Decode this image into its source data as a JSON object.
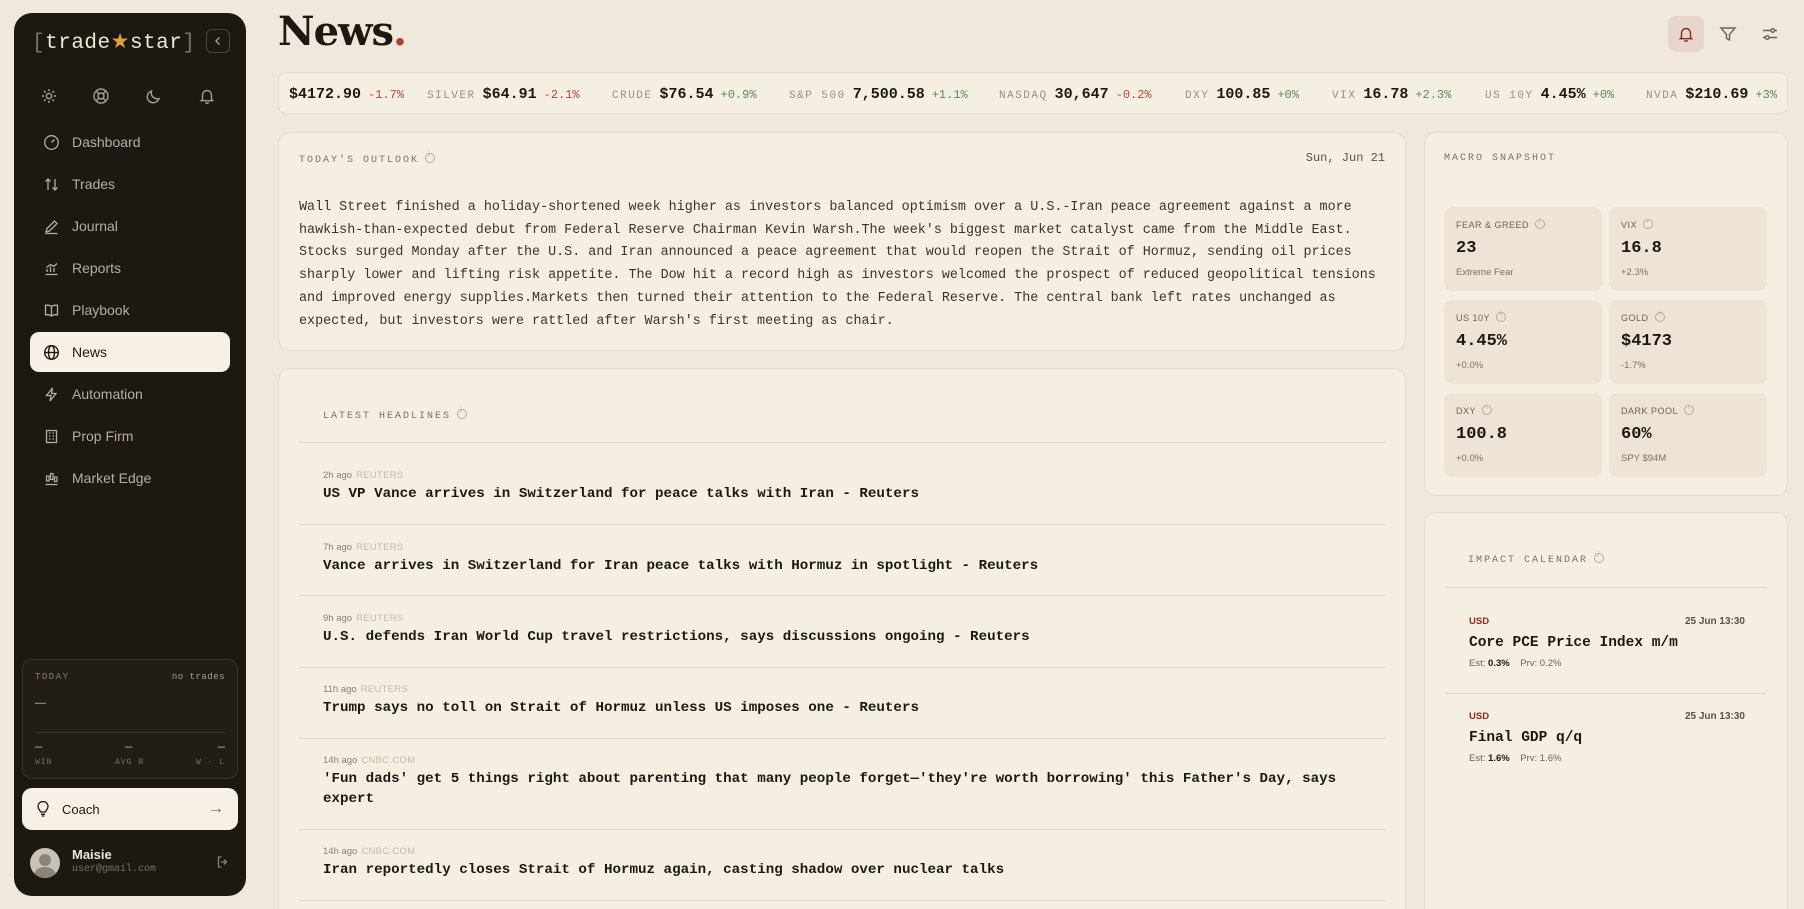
{
  "app": {
    "logo_left": "[",
    "logo_a": "trade",
    "logo_star": "★",
    "logo_b": "star",
    "logo_right": "]"
  },
  "sidebar": {
    "items": [
      {
        "label": "Dashboard",
        "icon": "dashboard-gauge-icon"
      },
      {
        "label": "Trades",
        "icon": "arrows-up-down-icon"
      },
      {
        "label": "Journal",
        "icon": "pen-icon"
      },
      {
        "label": "Reports",
        "icon": "chart-icon"
      },
      {
        "label": "Playbook",
        "icon": "book-icon"
      },
      {
        "label": "News",
        "icon": "globe-icon",
        "active": true
      },
      {
        "label": "Automation",
        "icon": "lightning-icon"
      },
      {
        "label": "Prop Firm",
        "icon": "building-icon"
      },
      {
        "label": "Market Edge",
        "icon": "candles-icon"
      }
    ],
    "today": {
      "label": "TODAY",
      "status": "no trades",
      "value": "—",
      "win_value": "—",
      "win_label": "WIN",
      "avgr_value": "—",
      "avgr_label": "AVG R",
      "wl_value": "—",
      "wl_label": "W · L"
    },
    "coach": {
      "label": "Coach",
      "arrow": "→"
    },
    "user": {
      "name": "Maisie",
      "email": "user@gmail.com"
    }
  },
  "header": {
    "title": "News",
    "title_dot": "."
  },
  "ticker": [
    {
      "symbol": "",
      "value": "$4172.90",
      "change": "-1.7%",
      "dir": "neg"
    },
    {
      "symbol": "SILVER",
      "value": "$64.91",
      "change": "-2.1%",
      "dir": "neg"
    },
    {
      "symbol": "CRUDE",
      "value": "$76.54",
      "change": "+0.9%",
      "dir": "pos"
    },
    {
      "symbol": "S&P 500",
      "value": "7,500.58",
      "change": "+1.1%",
      "dir": "pos"
    },
    {
      "symbol": "NASDAQ",
      "value": "30,647",
      "change": "-0.2%",
      "dir": "neg"
    },
    {
      "symbol": "DXY",
      "value": "100.85",
      "change": "+0%",
      "dir": "pos"
    },
    {
      "symbol": "VIX",
      "value": "16.78",
      "change": "+2.3%",
      "dir": "pos"
    },
    {
      "symbol": "US 10Y",
      "value": "4.45%",
      "change": "+0%",
      "dir": "pos"
    },
    {
      "symbol": "NVDA",
      "value": "$210.69",
      "change": "+3%",
      "dir": "pos"
    }
  ],
  "outlook": {
    "label": "TODAY'S OUTLOOK",
    "date": "Sun, Jun 21",
    "text": "Wall Street finished a holiday-shortened week higher as investors balanced optimism over a U.S.-Iran peace agreement against a more hawkish-than-expected debut from Federal Reserve Chairman Kevin Warsh.The week's biggest market catalyst came from the Middle East. Stocks surged Monday after the U.S. and Iran announced a peace agreement that would reopen the Strait of Hormuz, sending oil prices sharply lower and lifting risk appetite. The Dow hit a record high as investors welcomed the prospect of reduced geopolitical tensions and improved energy supplies.Markets then turned their attention to the Federal Reserve. The central bank left rates unchanged as expected, but investors were rattled after Warsh's first meeting as chair."
  },
  "headlines": {
    "label": "LATEST HEADLINES",
    "items": [
      {
        "time": "2h ago",
        "source": "REUTERS",
        "title": "US VP Vance arrives in Switzerland for peace talks with Iran - Reuters"
      },
      {
        "time": "7h ago",
        "source": "REUTERS",
        "title": "Vance arrives in Switzerland for Iran peace talks with Hormuz in spotlight - Reuters"
      },
      {
        "time": "9h ago",
        "source": "REUTERS",
        "title": "U.S. defends Iran World Cup travel restrictions, says discussions ongoing - Reuters"
      },
      {
        "time": "11h ago",
        "source": "REUTERS",
        "title": "Trump says no toll on Strait of Hormuz unless US imposes one - Reuters"
      },
      {
        "time": "14h ago",
        "source": "CNBC.COM",
        "title": "'Fun dads' get 5 things right about parenting that many people forget—'they're worth borrowing' this Father's Day, says expert"
      },
      {
        "time": "14h ago",
        "source": "CNBC.COM",
        "title": "Iran reportedly closes Strait of Hormuz again, casting shadow over nuclear talks"
      }
    ]
  },
  "macro": {
    "label": "MACRO SNAPSHOT",
    "tiles": [
      {
        "label": "FEAR & GREED",
        "value": "23",
        "sub": "Extreme Fear",
        "sub_dir": "none"
      },
      {
        "label": "VIX",
        "value": "16.8",
        "sub": "+2.3%",
        "sub_dir": "pos"
      },
      {
        "label": "US 10Y",
        "value": "4.45%",
        "sub": "+0.0%",
        "sub_dir": "pos"
      },
      {
        "label": "GOLD",
        "value": "$4173",
        "sub": "-1.7%",
        "sub_dir": "neg"
      },
      {
        "label": "DXY",
        "value": "100.8",
        "sub": "+0.0%",
        "sub_dir": "pos"
      },
      {
        "label": "DARK POOL",
        "value": "60%",
        "sub": "SPY $94M",
        "sub_dir": "none"
      }
    ]
  },
  "calendar": {
    "label": "IMPACT CALENDAR",
    "events": [
      {
        "currency": "USD",
        "datetime": "25 Jun 13:30",
        "name": "Core PCE Price Index m/m",
        "est_label": "Est:",
        "est": "0.3%",
        "prv_label": "Prv:",
        "prv": "0.2%"
      },
      {
        "currency": "USD",
        "datetime": "25 Jun 13:30",
        "name": "Final GDP q/q",
        "est_label": "Est:",
        "est": "1.6%",
        "prv_label": "Prv:",
        "prv": "1.6%"
      }
    ]
  },
  "colors": {
    "background": "#f0e8dc",
    "sidebar": "#1c1812",
    "negative": "#b8453a",
    "positive": "#5c8a58",
    "accent_dot": "#b83a2a"
  }
}
